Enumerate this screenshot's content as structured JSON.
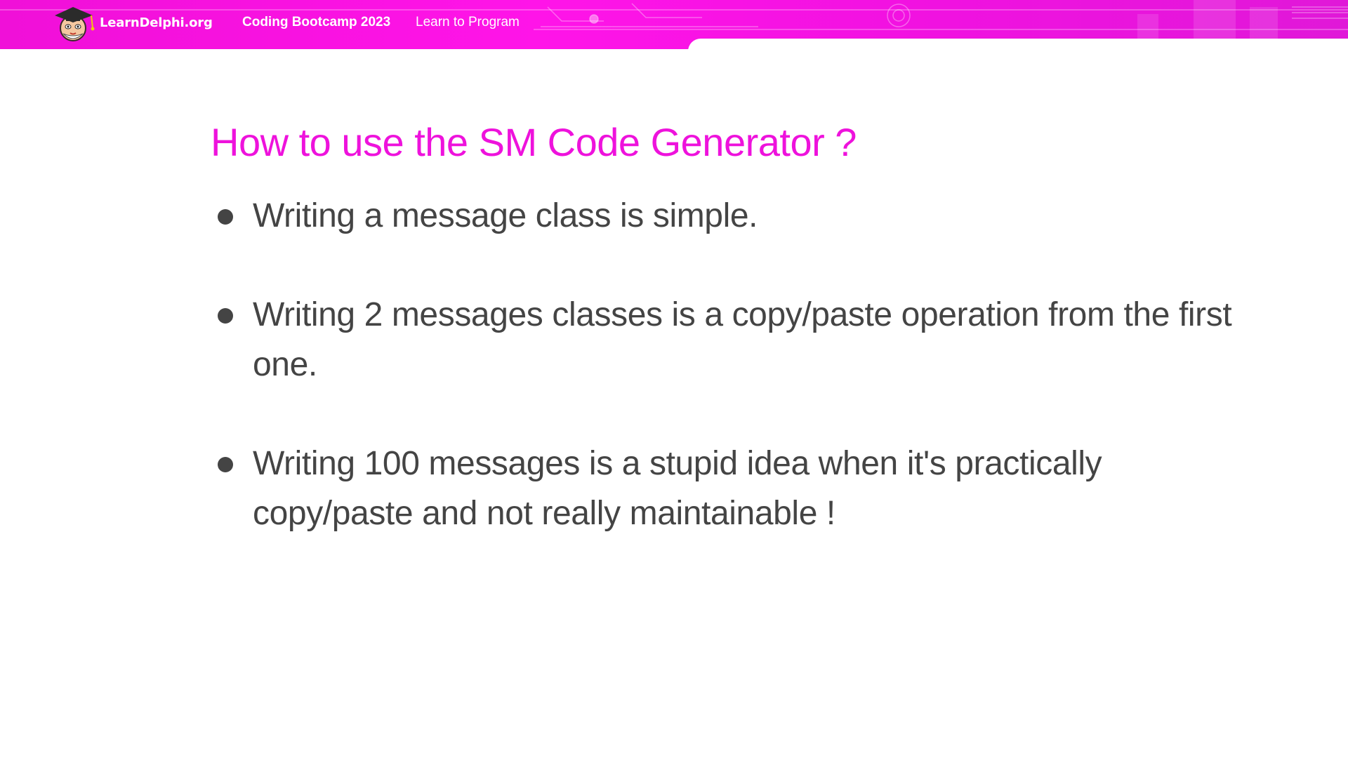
{
  "header": {
    "brand_name": "LearnDelphi.org",
    "logo_icon": "graduation-cap-mascot-logo",
    "course_title": "Coding Bootcamp 2023",
    "course_subtitle": "Learn to Program",
    "banner_color": "#ff14e8"
  },
  "slide": {
    "title": "How to use the SM Code Generator ?",
    "title_color": "#ee12dc",
    "text_color": "#444444",
    "bullets": [
      "Writing a message class is simple.",
      "Writing 2 messages classes is a copy/paste operation from the first one.",
      "Writing 100 messages is a stupid idea when it's practically copy/paste and not really maintainable !"
    ]
  }
}
